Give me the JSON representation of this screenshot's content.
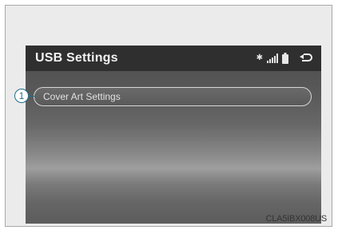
{
  "screen": {
    "title": "USB Settings",
    "status_icons": [
      "bluetooth-icon",
      "signal-icon",
      "battery-icon"
    ],
    "back_icon": "back-arrow-icon",
    "items": [
      {
        "label": "Cover Art Settings"
      }
    ]
  },
  "annotations": {
    "callout_number": "1",
    "image_code": "CLA5IBX008US"
  },
  "colors": {
    "title_bar": "#2f2f2f",
    "callout": "#1f6e8a"
  }
}
